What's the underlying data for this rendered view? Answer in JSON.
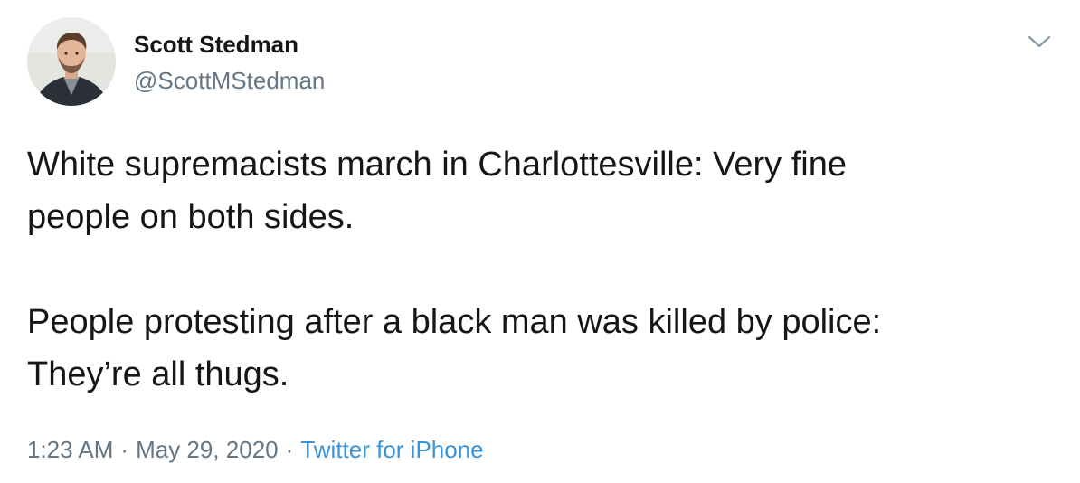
{
  "author": {
    "name": "Scott Stedman",
    "handle": "@ScottMStedman"
  },
  "tweet": {
    "lines": [
      "White supremacists march in Charlottesville: Very fine",
      "people on both sides.",
      "People protesting after a black man was killed by police:",
      "They’re all thugs."
    ]
  },
  "meta": {
    "time": "1:23 AM",
    "separator": "·",
    "date": "May 29, 2020",
    "source": "Twitter for iPhone"
  },
  "icons": {
    "menu": "chevron-down-icon"
  },
  "colors": {
    "text": "#14171a",
    "secondary": "#657786",
    "link": "#3b94d9"
  }
}
